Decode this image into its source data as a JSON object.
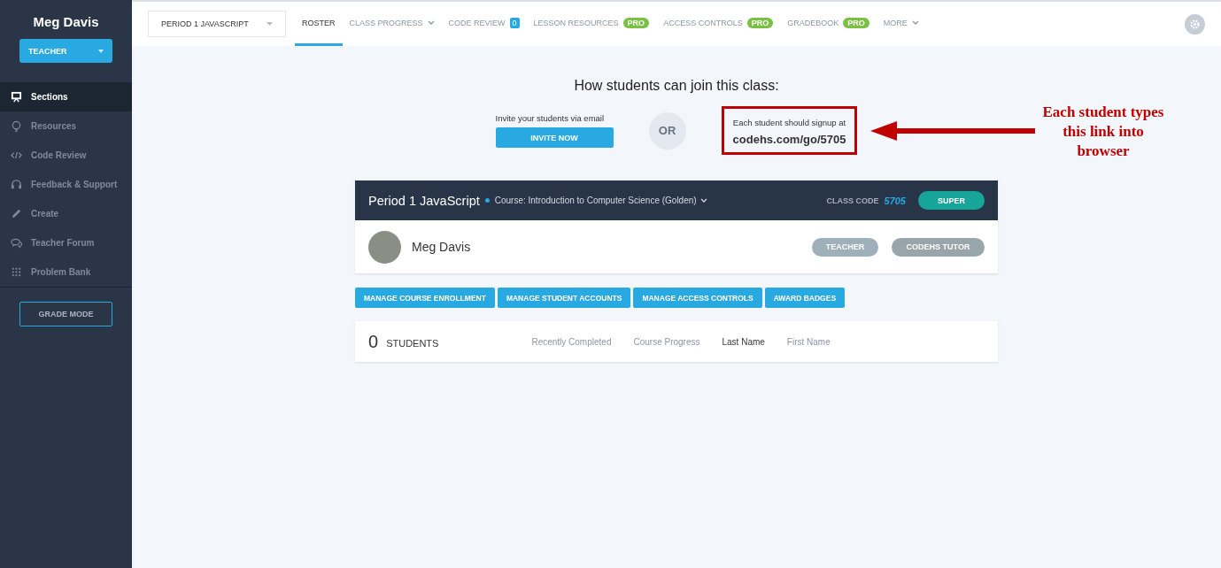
{
  "sidebar": {
    "user_name": "Meg Davis",
    "role_button": "TEACHER",
    "items": [
      {
        "label": "Sections",
        "selected": true
      },
      {
        "label": "Resources",
        "selected": false
      },
      {
        "label": "Code Review",
        "selected": false
      },
      {
        "label": "Feedback & Support",
        "selected": false
      },
      {
        "label": "Create",
        "selected": false
      },
      {
        "label": "Teacher Forum",
        "selected": false
      },
      {
        "label": "Problem Bank",
        "selected": false
      }
    ],
    "grade_mode_button": "GRADE MODE"
  },
  "top_nav": {
    "section_select": "PERIOD 1 JAVASCRIPT",
    "tabs": [
      {
        "label": "ROSTER",
        "selected": true,
        "kind": "plain"
      },
      {
        "label": "CLASS PROGRESS",
        "selected": false,
        "kind": "dropdown"
      },
      {
        "label": "CODE REVIEW",
        "selected": false,
        "kind": "count",
        "badge": "0"
      },
      {
        "label": "LESSON RESOURCES",
        "selected": false,
        "kind": "pro",
        "badge": "PRO"
      },
      {
        "label": "ACCESS CONTROLS",
        "selected": false,
        "kind": "pro",
        "badge": "PRO"
      },
      {
        "label": "GRADEBOOK",
        "selected": false,
        "kind": "pro",
        "badge": "PRO"
      },
      {
        "label": "MORE",
        "selected": false,
        "kind": "dropdown"
      }
    ]
  },
  "join": {
    "title": "How students can join this class:",
    "invite_text": "Invite your students via email",
    "invite_button": "INVITE NOW",
    "or_label": "OR",
    "signup_text": "Each student should signup at",
    "signup_link": "codehs.com/go/5705",
    "highlighted": true,
    "annotation": "Each student types this link into browser"
  },
  "class_card": {
    "class_name": "Period 1 JavaScript",
    "course": "Course: Introduction to Computer Science (Golden)",
    "class_code_label": "CLASS CODE",
    "class_code": "5705",
    "plan_button": "SUPER",
    "teacher_name": "Meg Davis",
    "roles": [
      "TEACHER",
      "CODEHS TUTOR"
    ]
  },
  "actions": [
    "MANAGE COURSE ENROLLMENT",
    "MANAGE STUDENT ACCOUNTS",
    "MANAGE ACCESS CONTROLS",
    "AWARD BADGES"
  ],
  "roster": {
    "count": "0",
    "count_label": "STUDENTS",
    "sort_columns": [
      {
        "label": "Recently Completed",
        "selected": false
      },
      {
        "label": "Course Progress",
        "selected": false
      },
      {
        "label": "Last Name",
        "selected": true
      },
      {
        "label": "First Name",
        "selected": false
      }
    ]
  }
}
